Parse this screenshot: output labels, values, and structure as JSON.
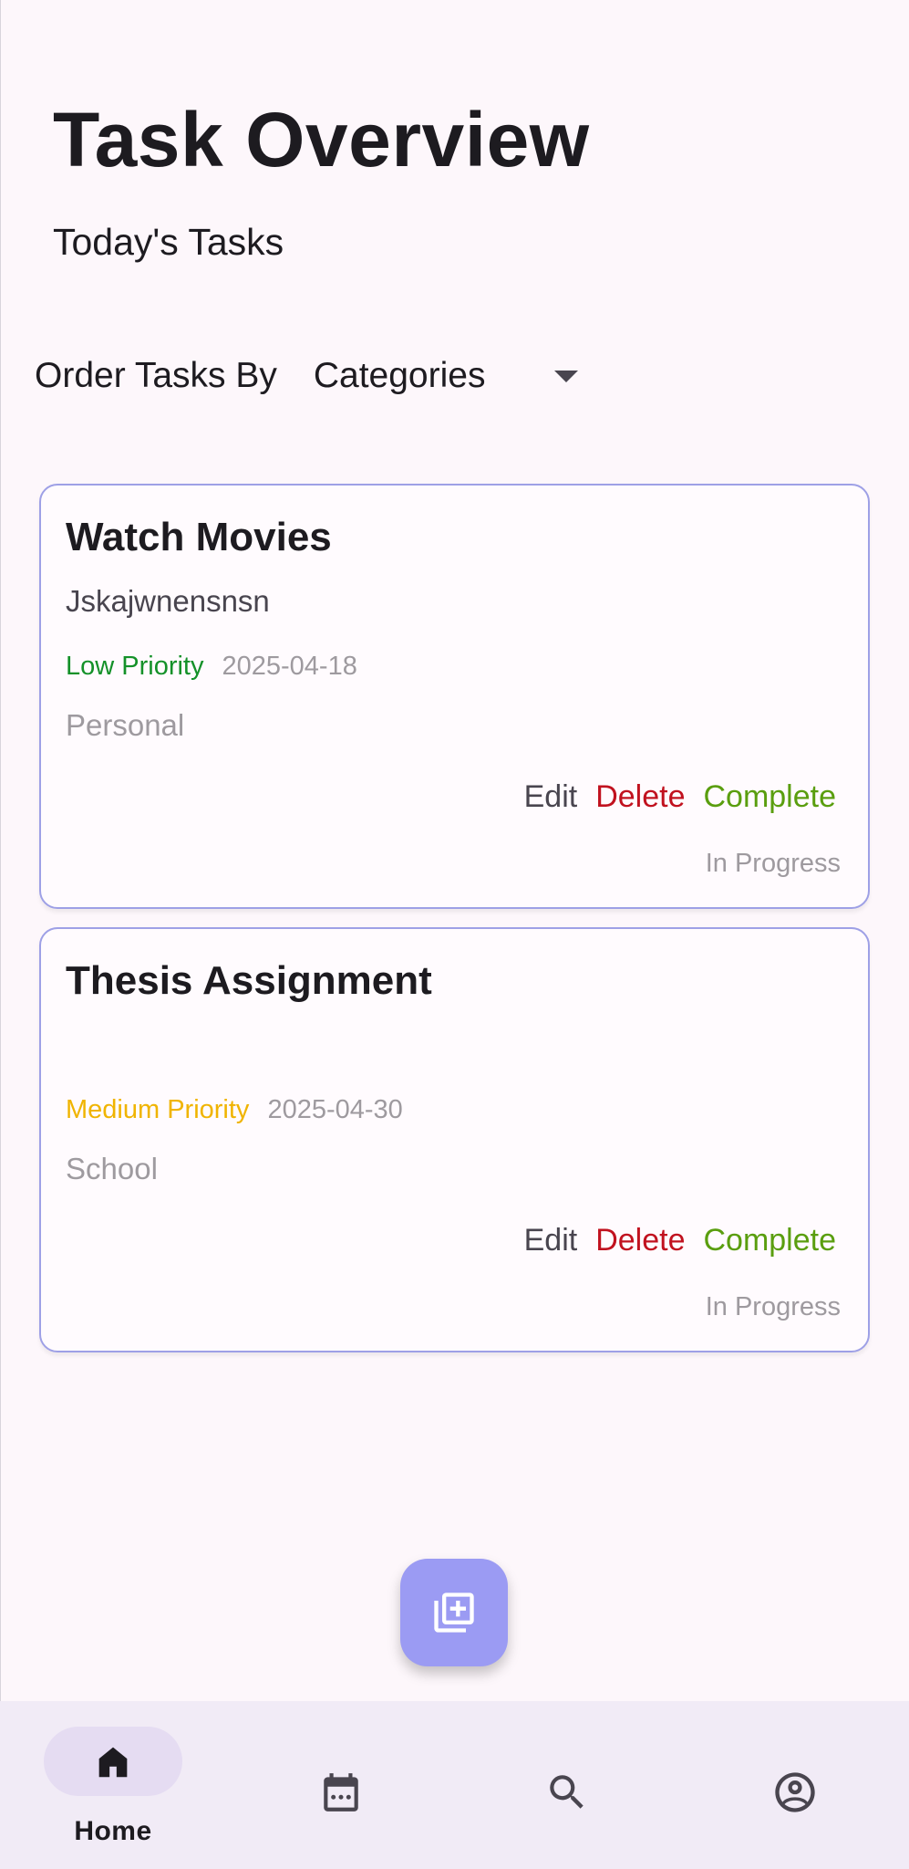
{
  "header": {
    "title": "Task Overview",
    "subtitle": "Today's Tasks"
  },
  "sort": {
    "label": "Order Tasks By",
    "selected": "Categories"
  },
  "tasks": [
    {
      "title": "Watch Movies",
      "description": "Jskajwnensnsn",
      "priority": "Low Priority",
      "priority_color": "#149129",
      "date": "2025-04-18",
      "category": "Personal",
      "status": "In Progress"
    },
    {
      "title": "Thesis Assignment",
      "description": "",
      "priority": "Medium Priority",
      "priority_color": "#f0b400",
      "date": "2025-04-30",
      "category": "School",
      "status": "In Progress"
    }
  ],
  "actions": {
    "edit": "Edit",
    "delete": "Delete",
    "complete": "Complete"
  },
  "fab": {
    "icon": "add-to-library-icon"
  },
  "nav": {
    "items": [
      {
        "label": "Home",
        "icon": "home-icon",
        "active": true
      },
      {
        "label": "",
        "icon": "calendar-icon",
        "active": false
      },
      {
        "label": "",
        "icon": "search-icon",
        "active": false
      },
      {
        "label": "",
        "icon": "account-circle-icon",
        "active": false
      }
    ]
  },
  "colors": {
    "background": "#fdf7fb",
    "card_border": "#9ea0e6",
    "fab": "#9b9bf3",
    "navbar": "#f1ebf6",
    "delete": "#c1121f",
    "complete": "#5a9e0f"
  }
}
